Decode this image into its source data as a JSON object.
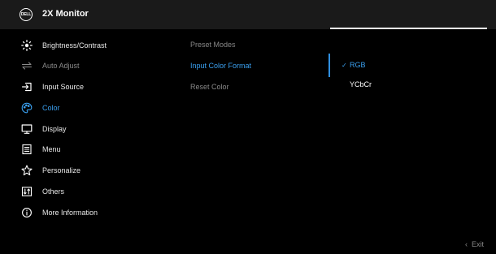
{
  "header": {
    "logo_text": "DELL",
    "title": "2X Monitor"
  },
  "menu": {
    "items": [
      {
        "label": "Brightness/Contrast",
        "icon": "brightness-icon",
        "state": "normal"
      },
      {
        "label": "Auto Adjust",
        "icon": "auto-adjust-icon",
        "state": "disabled"
      },
      {
        "label": "Input Source",
        "icon": "input-source-icon",
        "state": "normal"
      },
      {
        "label": "Color",
        "icon": "color-icon",
        "state": "active"
      },
      {
        "label": "Display",
        "icon": "display-icon",
        "state": "normal"
      },
      {
        "label": "Menu",
        "icon": "menu-icon",
        "state": "normal"
      },
      {
        "label": "Personalize",
        "icon": "star-icon",
        "state": "normal"
      },
      {
        "label": "Others",
        "icon": "others-icon",
        "state": "normal"
      },
      {
        "label": "More Information",
        "icon": "info-icon",
        "state": "normal"
      }
    ]
  },
  "submenu": {
    "items": [
      {
        "label": "Preset Modes",
        "state": "normal"
      },
      {
        "label": "Input Color Format",
        "state": "active"
      },
      {
        "label": "Reset Color",
        "state": "normal"
      }
    ]
  },
  "options": {
    "items": [
      {
        "label": "RGB",
        "selected": true,
        "check": "✓"
      },
      {
        "label": "YCbCr",
        "selected": false
      }
    ]
  },
  "footer": {
    "exit_label": "Exit"
  },
  "colors": {
    "accent": "#3aa0f0",
    "header_bg": "#1a1a1a",
    "background": "#000000"
  }
}
